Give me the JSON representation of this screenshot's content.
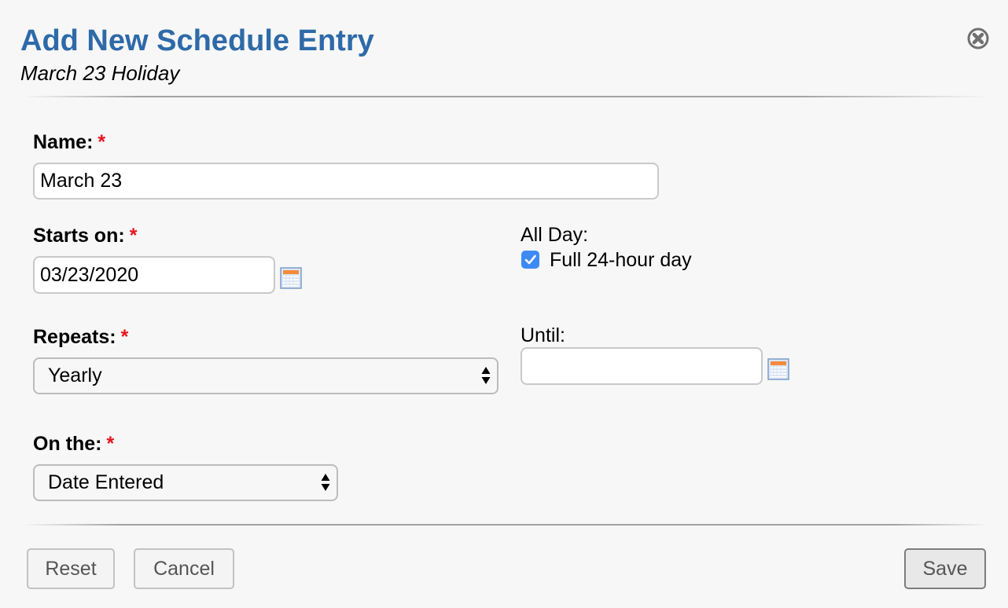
{
  "header": {
    "title": "Add New Schedule Entry",
    "subtitle": "March 23 Holiday",
    "close_icon": "close-circle-icon"
  },
  "form": {
    "name": {
      "label": "Name:",
      "required_mark": "*",
      "value": "March 23"
    },
    "starts_on": {
      "label": "Starts on:",
      "required_mark": "*",
      "value": "03/23/2020",
      "icon": "calendar-icon"
    },
    "all_day": {
      "label": "All Day:",
      "checkbox_label": "Full 24-hour day",
      "checked": true
    },
    "repeats": {
      "label": "Repeats:",
      "required_mark": "*",
      "selected": "Yearly"
    },
    "until": {
      "label": "Until:",
      "value": "",
      "icon": "calendar-icon"
    },
    "on_the": {
      "label": "On the:",
      "required_mark": "*",
      "selected": "Date Entered"
    }
  },
  "footer": {
    "reset_label": "Reset",
    "cancel_label": "Cancel",
    "save_label": "Save"
  },
  "colors": {
    "title": "#2e6aa8",
    "required": "#e8131c",
    "checkbox": "#3e8af4",
    "background": "#f7f7f7"
  }
}
